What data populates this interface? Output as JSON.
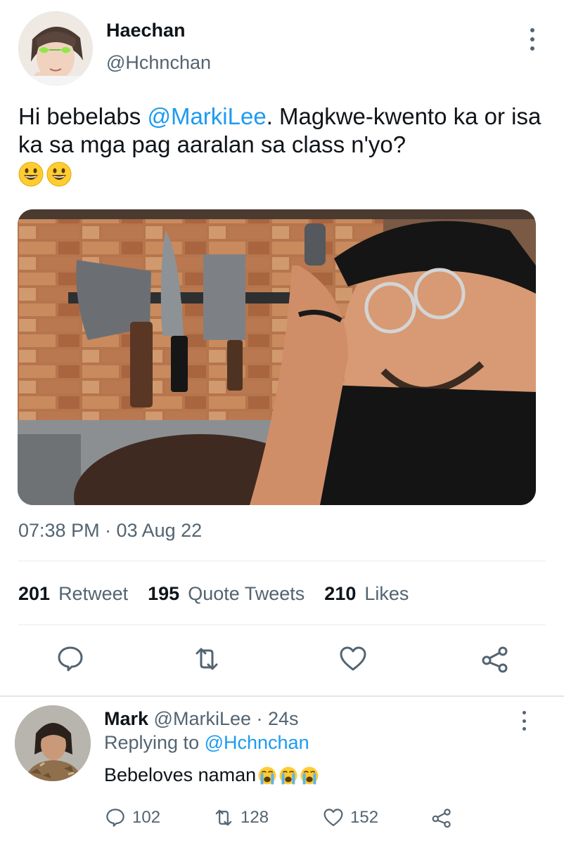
{
  "tweet": {
    "author_name": "Haechan",
    "author_handle": "@Hchnchan",
    "text_before": "Hi bebelabs ",
    "mention": "@MarkiLee",
    "text_after": ". Magkwe-kwento ka or isa ka sa mga pag aaralan sa class n'yo?",
    "emojis": [
      "grinning-face-emoji",
      "grinning-face-emoji"
    ],
    "media_description_icon": "photo",
    "timestamp": "07:38 PM · 03 Aug 22",
    "stats": [
      {
        "count": "201",
        "label": "Retweet"
      },
      {
        "count": "195",
        "label": "Quote Tweets"
      },
      {
        "count": "210",
        "label": "Likes"
      }
    ],
    "actions": [
      "reply-icon",
      "retweet-icon",
      "like-icon",
      "share-icon"
    ]
  },
  "reply": {
    "author_name": "Mark",
    "author_handle": "@MarkiLee · 24s",
    "replying_prefix": "Replying to ",
    "replying_mention": "@Hchnchan",
    "text": "Bebeloves naman ",
    "emojis": [
      "loudly-crying-face-emoji",
      "loudly-crying-face-emoji",
      "loudly-crying-face-emoji"
    ],
    "counts": {
      "replies": "102",
      "retweets": "128",
      "likes": "152"
    }
  },
  "colors": {
    "link": "#1d9bf0",
    "secondary_text": "#536471",
    "primary_text": "#0f1419",
    "icon": "#536471",
    "separator": "#e6ecf0"
  }
}
